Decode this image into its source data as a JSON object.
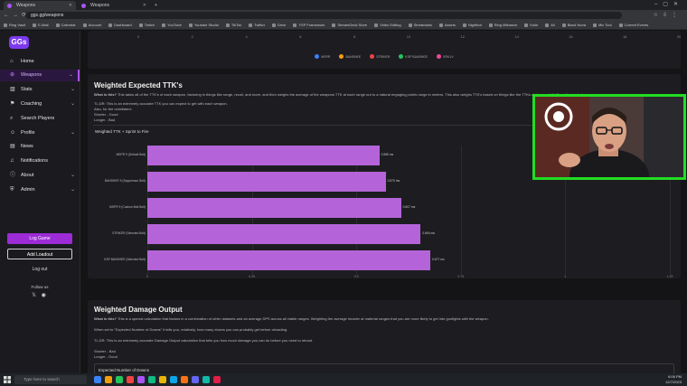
{
  "browser": {
    "tabs": [
      {
        "label": "Weapons",
        "active": true
      },
      {
        "label": "Weapons",
        "active": false
      }
    ],
    "new_tab": "+",
    "url": "ggs.gg/weapons",
    "bookmarks": [
      "Ring Vault",
      "E-Mail",
      "Calendar",
      "Account",
      "Dashboard",
      "Twitch",
      "YouTube",
      "Youtube Studio",
      "TikTok",
      "Twitter",
      "Drive",
      "YSP Framework",
      "StreamDeck Store",
      "Video Editing",
      "Streamlabs",
      "Assets",
      "Nightbot",
      "Ring Mfinance",
      "Kolin",
      "All",
      "Black Nova",
      "Mix Tool",
      "Current Events"
    ]
  },
  "sidebar": {
    "logo": "GGs",
    "items": [
      {
        "label": "Home",
        "icon": "home-icon",
        "glyph": "⌂",
        "chevron": false
      },
      {
        "label": "Weapons",
        "icon": "crosshair-icon",
        "glyph": "⊕",
        "chevron": true,
        "active": true
      },
      {
        "label": "Stats",
        "icon": "stats-icon",
        "glyph": "▥",
        "chevron": true
      },
      {
        "label": "Coaching",
        "icon": "coaching-icon",
        "glyph": "⚑",
        "chevron": true
      },
      {
        "label": "Search Players",
        "icon": "search-icon",
        "glyph": "⌕",
        "chevron": false
      },
      {
        "label": "Profile",
        "icon": "profile-icon",
        "glyph": "☺",
        "chevron": true
      },
      {
        "label": "News",
        "icon": "news-icon",
        "glyph": "▤",
        "chevron": false
      },
      {
        "label": "Notifications",
        "icon": "bell-icon",
        "glyph": "♫",
        "chevron": false
      },
      {
        "label": "About",
        "icon": "info-icon",
        "glyph": "ⓘ",
        "chevron": true
      },
      {
        "label": "Admin",
        "icon": "shield-icon",
        "glyph": "⛨",
        "chevron": true
      }
    ],
    "login_button": "Log Game",
    "loadout_button": "Add Loadout",
    "logout": "Log out",
    "follow_us": "Follow us",
    "social_icons": "𝕏  ◉"
  },
  "top_chart": {
    "ticks": [
      "0",
      "2",
      "4",
      "6",
      "8",
      "10",
      "12",
      "14",
      "16",
      "18",
      "20"
    ],
    "legend": [
      {
        "label": "MSPR",
        "color": "#3b82f6"
      },
      {
        "label": "BANSHEE",
        "color": "#f59e0b"
      },
      {
        "label": "STRIKER",
        "color": "#ef4444"
      },
      {
        "label": "KSP BANSHEE",
        "color": "#22c55e"
      },
      {
        "label": "XRK-IV",
        "color": "#ec4899"
      }
    ]
  },
  "ttk_card": {
    "title": "Weighted Expected TTK's",
    "what_label": "What is this?",
    "what_text": "This takes all of the TTK's of each weapon, factoring in things like range, recoil, and more, and then weighs the average of the weapons TTK at each range out to a natural engaging points range in meters. This also weighs TTK's based on things like the TTKs at damage falloff, and base stats.",
    "tldr": "TL;DR: This is an extremely accurate TTK you can expect to get with each weapon.",
    "notes": [
      "Also, for the uninitiated:",
      "Shorter - Good",
      "Longer - Bad"
    ],
    "panel_title": "Weighted TTK + Sprint to Fire",
    "x_ticks": [
      "0",
      "0.25",
      "0.5",
      "0.75",
      "1",
      "1.25"
    ],
    "chart_data": {
      "type": "bar",
      "orientation": "horizontal",
      "title": "Weighted TTK + Sprint to Fire",
      "categories": [
        "MSPR 9 (Default Bolt)",
        "BANSHEE 9 (Suppressor Bolt)",
        "MSPR 9 (Custom Bolt Bolt)",
        "STRIKER (Selected Bolt)",
        "KSP BANSHEE (Selected Bolt)"
      ],
      "values": [
        0.555,
        0.57,
        0.607,
        0.654,
        0.677
      ],
      "value_labels": [
        "0.555 ms",
        "0.570 ms",
        "0.607 ms",
        "0.654 ms",
        "0.677 ms"
      ],
      "xlim": [
        0,
        1.25
      ],
      "xlabel": "",
      "ylabel": "",
      "color": "#b464d8"
    }
  },
  "damage_card": {
    "title": "Weighted Damage Output",
    "what_label": "What is this?",
    "what_text": "This is a special calculation that factors in a combination of other datasets and an average DPS across all viable ranges. Weighting the average heavier at material ranges that you are more likely to get into gunfights with the weapon.",
    "expected_text": "When set to \"Expected Number of Downs\" it tells you, relatively, how many downs you can probably get before reloading.",
    "tldr": "TL;DR: This is an extremely accurate Damage Output calculation that tells you how much damage you can do before you need to reload.",
    "notes": [
      "Shorter - Bad",
      "Longer - Good"
    ],
    "select_value": "Expected Number of Downs"
  },
  "taskbar": {
    "search_placeholder": "Type here to search",
    "time": "6:06 PM",
    "date": "12/7/2023"
  },
  "colors": {
    "accent": "#a855f7",
    "bar": "#b464d8",
    "webcam_border": "#22dd22"
  }
}
